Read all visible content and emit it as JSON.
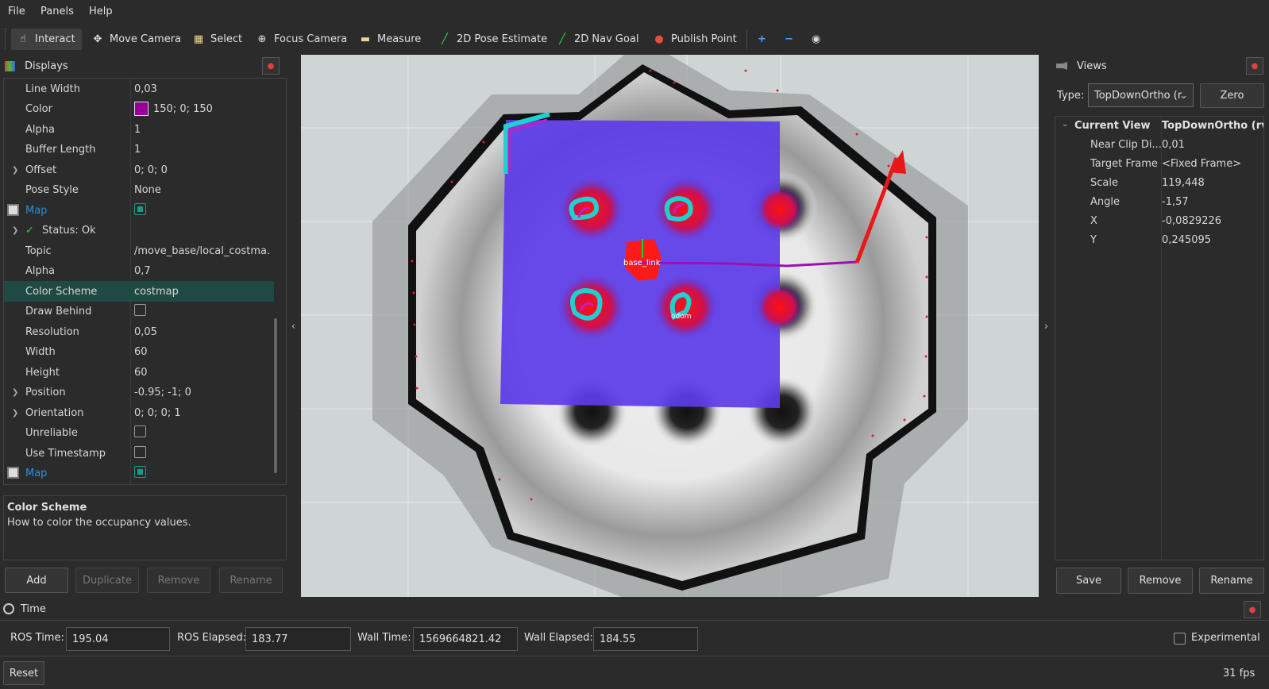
{
  "menu": [
    "File",
    "Panels",
    "Help"
  ],
  "toolbar": {
    "tools": [
      "Interact",
      "Move Camera",
      "Select",
      "Focus Camera",
      "Measure",
      "2D Pose Estimate",
      "2D Nav Goal",
      "Publish Point"
    ],
    "icons": [
      "interact-icon",
      "move-camera-icon",
      "select-icon",
      "focus-camera-icon",
      "measure-icon",
      "pose-estimate-icon",
      "nav-goal-icon",
      "publish-point-icon",
      "plus-icon",
      "minus-icon",
      "eye-icon"
    ]
  },
  "displays": {
    "title": "Displays",
    "rows": [
      {
        "key": "Line Width",
        "value": "0,03"
      },
      {
        "key": "Color",
        "value": "150; 0; 150"
      },
      {
        "key": "Alpha",
        "value": "1"
      },
      {
        "key": "Buffer Length",
        "value": "1"
      },
      {
        "key": "Offset",
        "value": "0; 0; 0"
      },
      {
        "key": "Pose Style",
        "value": "None"
      },
      {
        "key": "Map",
        "value": ""
      },
      {
        "key": "Status: Ok",
        "value": ""
      },
      {
        "key": "Topic",
        "value": "/move_base/local_costma..."
      },
      {
        "key": "Alpha",
        "value": "0,7"
      },
      {
        "key": "Color Scheme",
        "value": "costmap"
      },
      {
        "key": "Draw Behind",
        "value": ""
      },
      {
        "key": "Resolution",
        "value": "0,05"
      },
      {
        "key": "Width",
        "value": "60"
      },
      {
        "key": "Height",
        "value": "60"
      },
      {
        "key": "Position",
        "value": "-0.95; -1; 0"
      },
      {
        "key": "Orientation",
        "value": "0; 0; 0; 1"
      },
      {
        "key": "Unreliable",
        "value": ""
      },
      {
        "key": "Use Timestamp",
        "value": ""
      },
      {
        "key": "Map",
        "value": ""
      }
    ],
    "color_swatch": "#960096",
    "help_title": "Color Scheme",
    "help_text": "How to color the occupancy values.",
    "buttons": [
      "Add",
      "Duplicate",
      "Remove",
      "Rename"
    ]
  },
  "viewport": {
    "labels": [
      "base_link",
      "odom"
    ]
  },
  "views": {
    "title": "Views",
    "type_label": "Type:",
    "type_value": "TopDownOrtho (r",
    "zero": "Zero",
    "current_view": "Current View",
    "current_view_value": "TopDownOrtho (rv...",
    "rows": [
      {
        "key": "Near Clip Di...",
        "value": "0,01"
      },
      {
        "key": "Target Frame",
        "value": "<Fixed Frame>"
      },
      {
        "key": "Scale",
        "value": "119,448"
      },
      {
        "key": "Angle",
        "value": "-1,57"
      },
      {
        "key": "X",
        "value": "-0,0829226"
      },
      {
        "key": "Y",
        "value": "0,245095"
      }
    ],
    "buttons": [
      "Save",
      "Remove",
      "Rename"
    ]
  },
  "time": {
    "title": "Time",
    "ros_time_label": "ROS Time:",
    "ros_time": "195.04",
    "ros_elapsed_label": "ROS Elapsed:",
    "ros_elapsed": "183.77",
    "wall_time_label": "Wall Time:",
    "wall_time": "1569664821.42",
    "wall_elapsed_label": "Wall Elapsed:",
    "wall_elapsed": "184.55",
    "experimental": "Experimental"
  },
  "status": {
    "reset": "Reset",
    "fps": "31 fps"
  },
  "colors": {
    "accent": "#2a8fd8",
    "selection": "#1f4a44",
    "checkbox": "#1a9a8a"
  }
}
